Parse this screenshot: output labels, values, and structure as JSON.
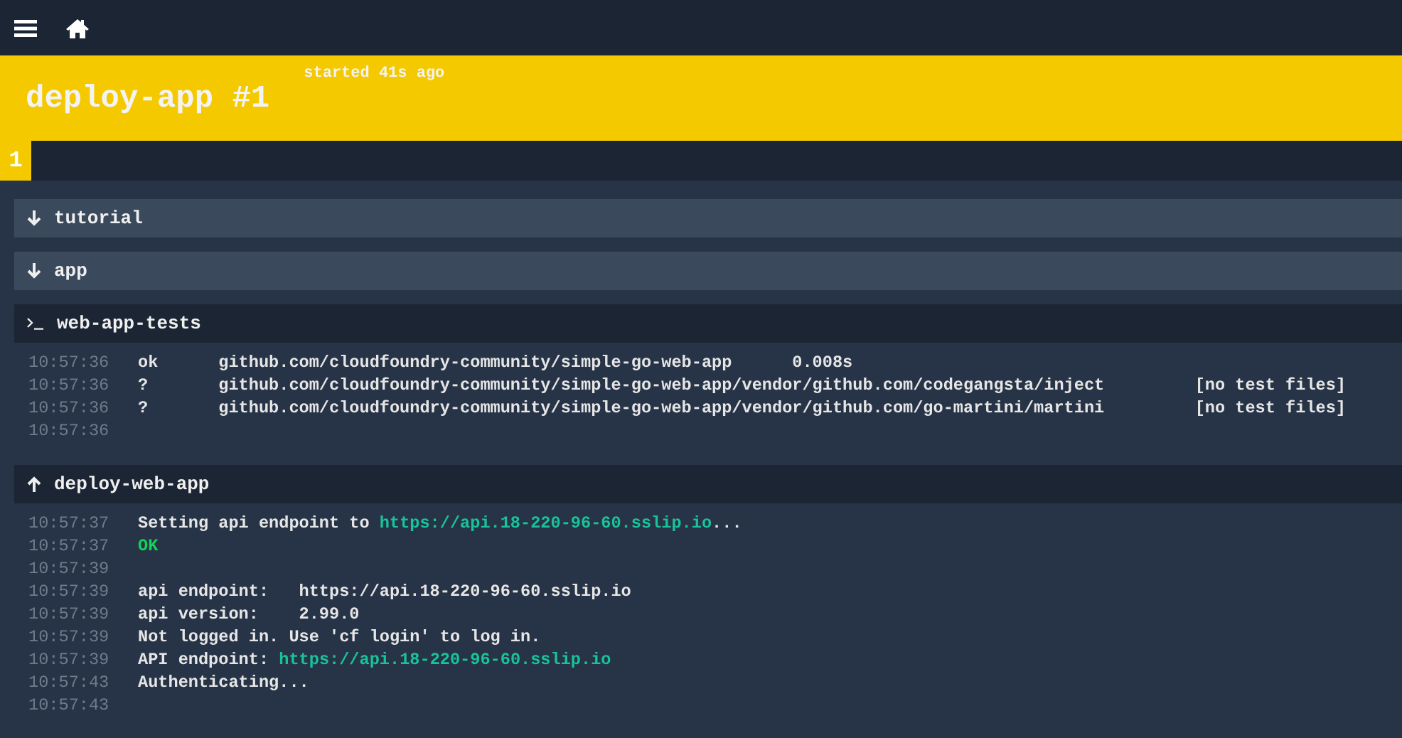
{
  "header": {
    "title": "deploy-app #1",
    "status": "started 41s ago"
  },
  "builds": [
    {
      "label": "1",
      "selected": true
    }
  ],
  "steps": [
    {
      "name": "tutorial",
      "kind": "collapsed"
    },
    {
      "name": "app",
      "kind": "collapsed"
    },
    {
      "name": "web-app-tests",
      "kind": "running",
      "lines": [
        {
          "time": "10:57:36",
          "parts": [
            {
              "kind": "plain",
              "text": "ok      github.com/cloudfoundry-community/simple-go-web-app      0.008s"
            }
          ]
        },
        {
          "time": "10:57:36",
          "parts": [
            {
              "kind": "plain",
              "text": "?       github.com/cloudfoundry-community/simple-go-web-app/vendor/github.com/codegangsta/inject         [no test files]"
            }
          ]
        },
        {
          "time": "10:57:36",
          "parts": [
            {
              "kind": "plain",
              "text": "?       github.com/cloudfoundry-community/simple-go-web-app/vendor/github.com/go-martini/martini         [no test files]"
            }
          ]
        },
        {
          "time": "10:57:36"
        }
      ]
    },
    {
      "name": "deploy-web-app",
      "kind": "expanded",
      "lines": [
        {
          "time": "10:57:37",
          "parts": [
            {
              "kind": "plain",
              "text": "Setting api endpoint to "
            },
            {
              "kind": "link",
              "text": "https://api.18-220-96-60.sslip.io"
            },
            {
              "kind": "plain",
              "text": "..."
            }
          ]
        },
        {
          "time": "10:57:37",
          "parts": [
            {
              "kind": "ok",
              "text": "OK"
            }
          ]
        },
        {
          "time": "10:57:39"
        },
        {
          "time": "10:57:39",
          "parts": [
            {
              "kind": "plain",
              "text": "api endpoint:   https://api.18-220-96-60.sslip.io"
            }
          ]
        },
        {
          "time": "10:57:39",
          "parts": [
            {
              "kind": "plain",
              "text": "api version:    2.99.0"
            }
          ]
        },
        {
          "time": "10:57:39",
          "parts": [
            {
              "kind": "plain",
              "text": "Not logged in. Use 'cf login' to log in."
            }
          ]
        },
        {
          "time": "10:57:39",
          "parts": [
            {
              "kind": "plain",
              "text": "API endpoint: "
            },
            {
              "kind": "link",
              "text": "https://api.18-220-96-60.sslip.io"
            }
          ]
        },
        {
          "time": "10:57:43",
          "parts": [
            {
              "kind": "plain",
              "text": "Authenticating..."
            }
          ]
        },
        {
          "time": "10:57:43"
        }
      ]
    }
  ]
}
